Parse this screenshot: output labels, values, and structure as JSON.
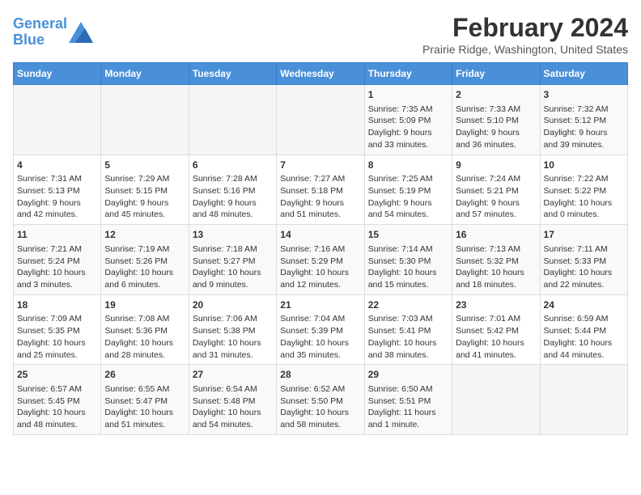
{
  "header": {
    "logo_line1": "General",
    "logo_line2": "Blue",
    "title": "February 2024",
    "subtitle": "Prairie Ridge, Washington, United States"
  },
  "days_of_week": [
    "Sunday",
    "Monday",
    "Tuesday",
    "Wednesday",
    "Thursday",
    "Friday",
    "Saturday"
  ],
  "weeks": [
    [
      {
        "day": "",
        "content": ""
      },
      {
        "day": "",
        "content": ""
      },
      {
        "day": "",
        "content": ""
      },
      {
        "day": "",
        "content": ""
      },
      {
        "day": "1",
        "content": "Sunrise: 7:35 AM\nSunset: 5:09 PM\nDaylight: 9 hours\nand 33 minutes."
      },
      {
        "day": "2",
        "content": "Sunrise: 7:33 AM\nSunset: 5:10 PM\nDaylight: 9 hours\nand 36 minutes."
      },
      {
        "day": "3",
        "content": "Sunrise: 7:32 AM\nSunset: 5:12 PM\nDaylight: 9 hours\nand 39 minutes."
      }
    ],
    [
      {
        "day": "4",
        "content": "Sunrise: 7:31 AM\nSunset: 5:13 PM\nDaylight: 9 hours\nand 42 minutes."
      },
      {
        "day": "5",
        "content": "Sunrise: 7:29 AM\nSunset: 5:15 PM\nDaylight: 9 hours\nand 45 minutes."
      },
      {
        "day": "6",
        "content": "Sunrise: 7:28 AM\nSunset: 5:16 PM\nDaylight: 9 hours\nand 48 minutes."
      },
      {
        "day": "7",
        "content": "Sunrise: 7:27 AM\nSunset: 5:18 PM\nDaylight: 9 hours\nand 51 minutes."
      },
      {
        "day": "8",
        "content": "Sunrise: 7:25 AM\nSunset: 5:19 PM\nDaylight: 9 hours\nand 54 minutes."
      },
      {
        "day": "9",
        "content": "Sunrise: 7:24 AM\nSunset: 5:21 PM\nDaylight: 9 hours\nand 57 minutes."
      },
      {
        "day": "10",
        "content": "Sunrise: 7:22 AM\nSunset: 5:22 PM\nDaylight: 10 hours\nand 0 minutes."
      }
    ],
    [
      {
        "day": "11",
        "content": "Sunrise: 7:21 AM\nSunset: 5:24 PM\nDaylight: 10 hours\nand 3 minutes."
      },
      {
        "day": "12",
        "content": "Sunrise: 7:19 AM\nSunset: 5:26 PM\nDaylight: 10 hours\nand 6 minutes."
      },
      {
        "day": "13",
        "content": "Sunrise: 7:18 AM\nSunset: 5:27 PM\nDaylight: 10 hours\nand 9 minutes."
      },
      {
        "day": "14",
        "content": "Sunrise: 7:16 AM\nSunset: 5:29 PM\nDaylight: 10 hours\nand 12 minutes."
      },
      {
        "day": "15",
        "content": "Sunrise: 7:14 AM\nSunset: 5:30 PM\nDaylight: 10 hours\nand 15 minutes."
      },
      {
        "day": "16",
        "content": "Sunrise: 7:13 AM\nSunset: 5:32 PM\nDaylight: 10 hours\nand 18 minutes."
      },
      {
        "day": "17",
        "content": "Sunrise: 7:11 AM\nSunset: 5:33 PM\nDaylight: 10 hours\nand 22 minutes."
      }
    ],
    [
      {
        "day": "18",
        "content": "Sunrise: 7:09 AM\nSunset: 5:35 PM\nDaylight: 10 hours\nand 25 minutes."
      },
      {
        "day": "19",
        "content": "Sunrise: 7:08 AM\nSunset: 5:36 PM\nDaylight: 10 hours\nand 28 minutes."
      },
      {
        "day": "20",
        "content": "Sunrise: 7:06 AM\nSunset: 5:38 PM\nDaylight: 10 hours\nand 31 minutes."
      },
      {
        "day": "21",
        "content": "Sunrise: 7:04 AM\nSunset: 5:39 PM\nDaylight: 10 hours\nand 35 minutes."
      },
      {
        "day": "22",
        "content": "Sunrise: 7:03 AM\nSunset: 5:41 PM\nDaylight: 10 hours\nand 38 minutes."
      },
      {
        "day": "23",
        "content": "Sunrise: 7:01 AM\nSunset: 5:42 PM\nDaylight: 10 hours\nand 41 minutes."
      },
      {
        "day": "24",
        "content": "Sunrise: 6:59 AM\nSunset: 5:44 PM\nDaylight: 10 hours\nand 44 minutes."
      }
    ],
    [
      {
        "day": "25",
        "content": "Sunrise: 6:57 AM\nSunset: 5:45 PM\nDaylight: 10 hours\nand 48 minutes."
      },
      {
        "day": "26",
        "content": "Sunrise: 6:55 AM\nSunset: 5:47 PM\nDaylight: 10 hours\nand 51 minutes."
      },
      {
        "day": "27",
        "content": "Sunrise: 6:54 AM\nSunset: 5:48 PM\nDaylight: 10 hours\nand 54 minutes."
      },
      {
        "day": "28",
        "content": "Sunrise: 6:52 AM\nSunset: 5:50 PM\nDaylight: 10 hours\nand 58 minutes."
      },
      {
        "day": "29",
        "content": "Sunrise: 6:50 AM\nSunset: 5:51 PM\nDaylight: 11 hours\nand 1 minute."
      },
      {
        "day": "",
        "content": ""
      },
      {
        "day": "",
        "content": ""
      }
    ]
  ]
}
